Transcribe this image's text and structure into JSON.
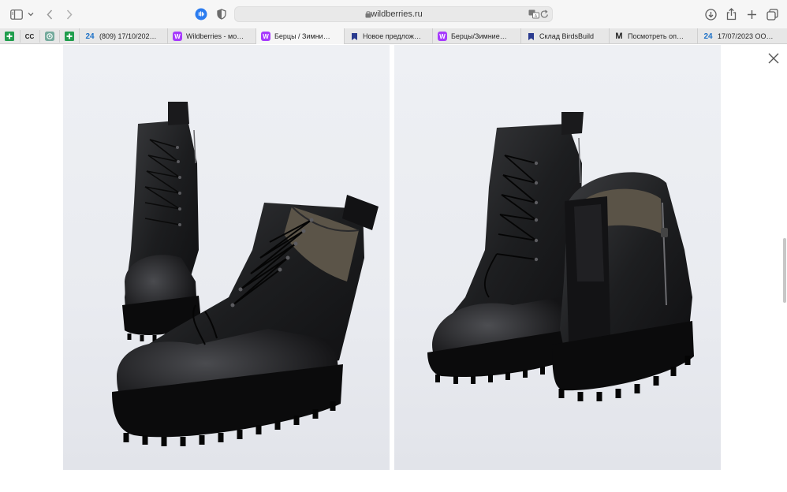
{
  "browser": {
    "address": "wildberries.ru",
    "pinned_tabs": [
      {
        "icon": "green-plus-icon",
        "label": ""
      },
      {
        "icon": "cc-icon",
        "label": "CC"
      },
      {
        "icon": "openai-icon",
        "label": ""
      },
      {
        "icon": "green-plus-icon",
        "label": ""
      }
    ],
    "tabs": [
      {
        "icon": "b24",
        "icon_text": "24",
        "label": "(809) 17/10/202…"
      },
      {
        "icon": "w",
        "icon_text": "W",
        "label": "Wildberries - мо…"
      },
      {
        "icon": "w",
        "icon_text": "W",
        "label": "Берцы / Зимни…",
        "active": true
      },
      {
        "icon": "sk",
        "icon_text": "",
        "label": "Новое предлож…"
      },
      {
        "icon": "w",
        "icon_text": "W",
        "label": "Берцы/Зимние…"
      },
      {
        "icon": "sk",
        "icon_text": "",
        "label": "Склад BirdsBuild"
      },
      {
        "icon": "m",
        "icon_text": "M",
        "label": "Посмотреть оп…"
      },
      {
        "icon": "b24",
        "icon_text": "24",
        "label": "17/07/2023 ОО…"
      }
    ]
  },
  "viewer": {
    "close_icon": "close-icon",
    "photos": [
      {
        "alt": "product-photo-boots-front"
      },
      {
        "alt": "product-photo-boots-back"
      }
    ]
  },
  "colors": {
    "wildberries": "#a73afd",
    "bitrix": "#1f72c7",
    "toolbar_bg": "#f6f6f6",
    "tabbar_bg": "#e7e7e7"
  }
}
